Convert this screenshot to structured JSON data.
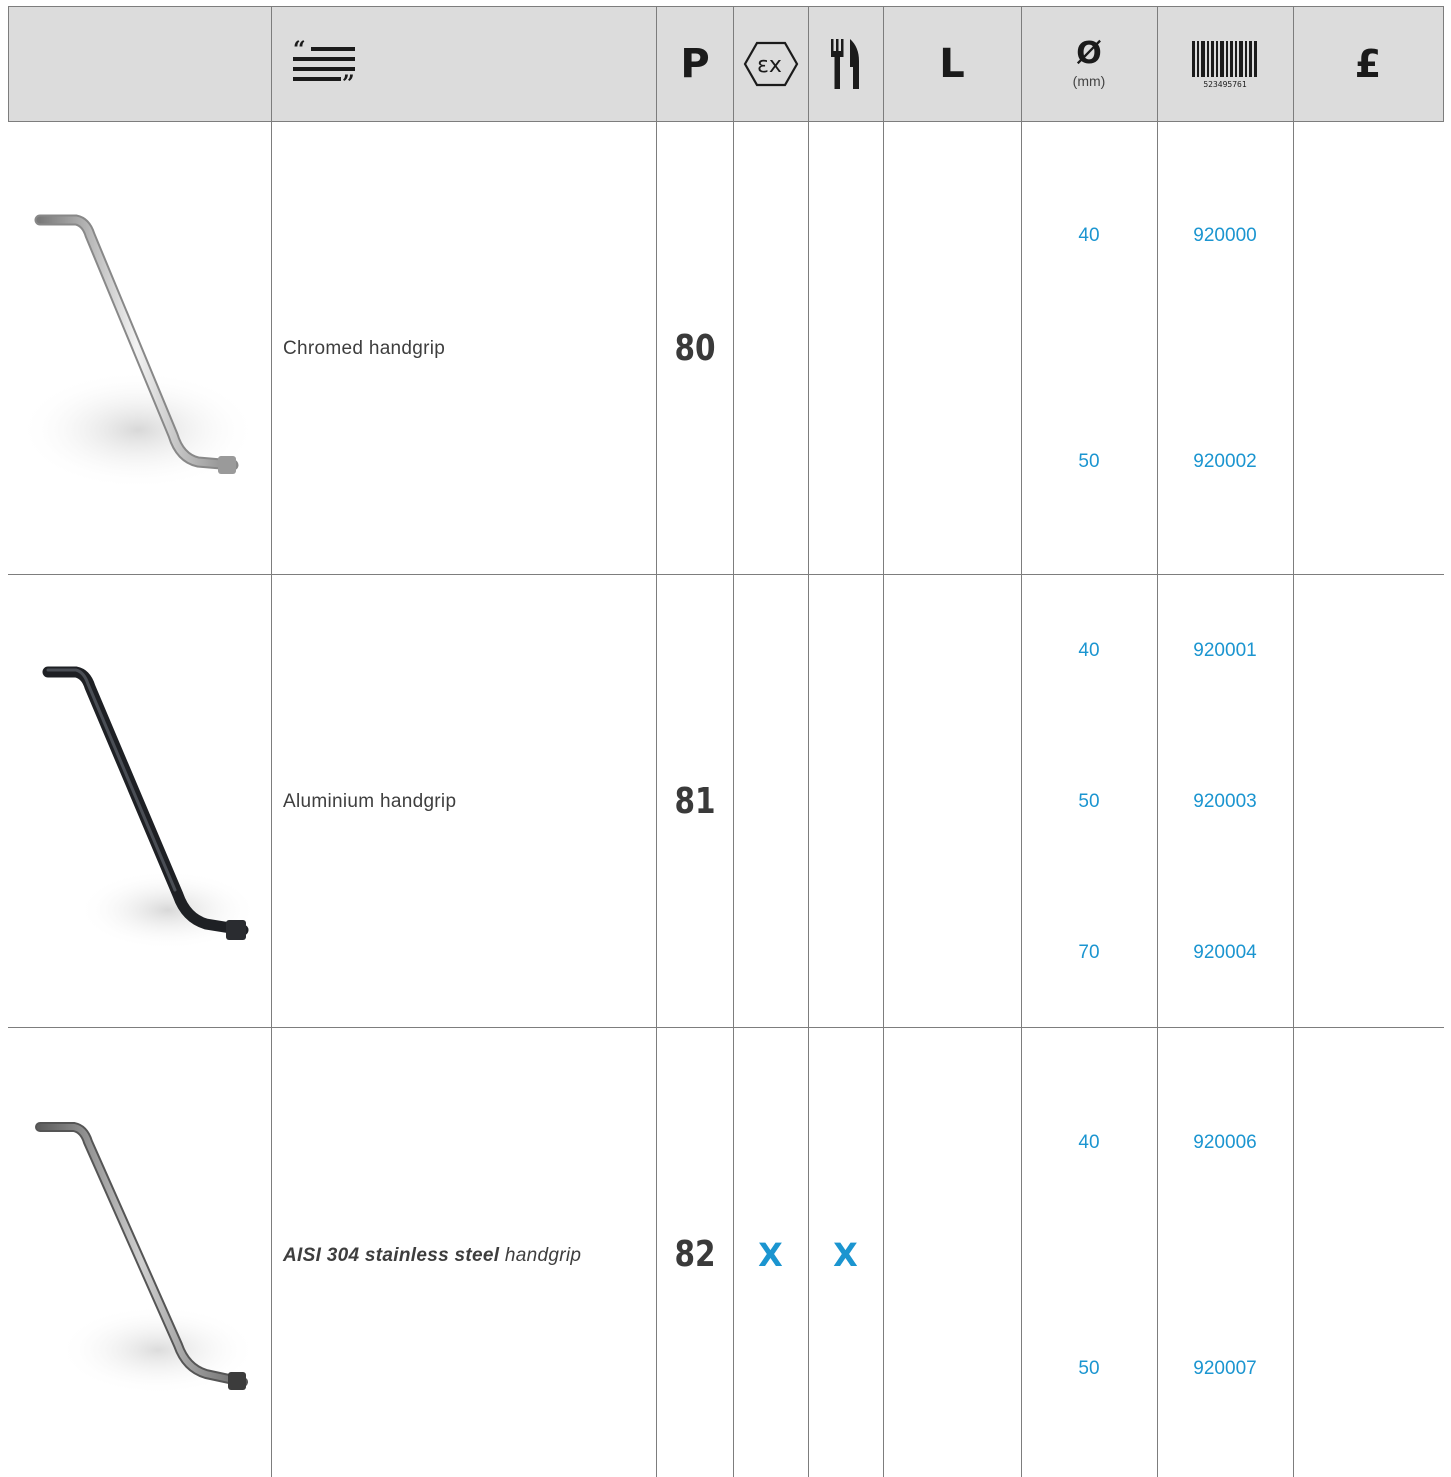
{
  "header": {
    "description_icon": "quote-lines-icon",
    "p_label": "P",
    "ex_icon": "atex-ex-icon",
    "food_icon": "fork-knife-icon",
    "l_label": "L",
    "diameter_symbol": "Ø",
    "diameter_unit": "(mm)",
    "barcode_icon": "barcode-icon",
    "barcode_number": "523495761",
    "price_symbol": "£"
  },
  "rows": [
    {
      "image": "chromed-handgrip-photo",
      "description": "Chromed handgrip",
      "p": "80",
      "ex": "",
      "food": "",
      "variants": [
        {
          "diameter": "40",
          "code": "920000"
        },
        {
          "diameter": "50",
          "code": "920002"
        }
      ]
    },
    {
      "image": "aluminium-handgrip-photo",
      "description": "Aluminium handgrip",
      "p": "81",
      "ex": "",
      "food": "",
      "variants": [
        {
          "diameter": "40",
          "code": "920001"
        },
        {
          "diameter": "50",
          "code": "920003"
        },
        {
          "diameter": "70",
          "code": "920004"
        }
      ]
    },
    {
      "image": "stainless-steel-handgrip-photo",
      "description_bold": "AISI 304 stainless steel",
      "description_rest": "handgrip",
      "p": "82",
      "ex": "X",
      "food": "X",
      "variants": [
        {
          "diameter": "40",
          "code": "920006"
        },
        {
          "diameter": "50",
          "code": "920007"
        }
      ]
    }
  ],
  "colors": {
    "header_bg": "#dcdcdc",
    "accent_blue": "#1b95d0",
    "grid": "#7d7d7d"
  }
}
